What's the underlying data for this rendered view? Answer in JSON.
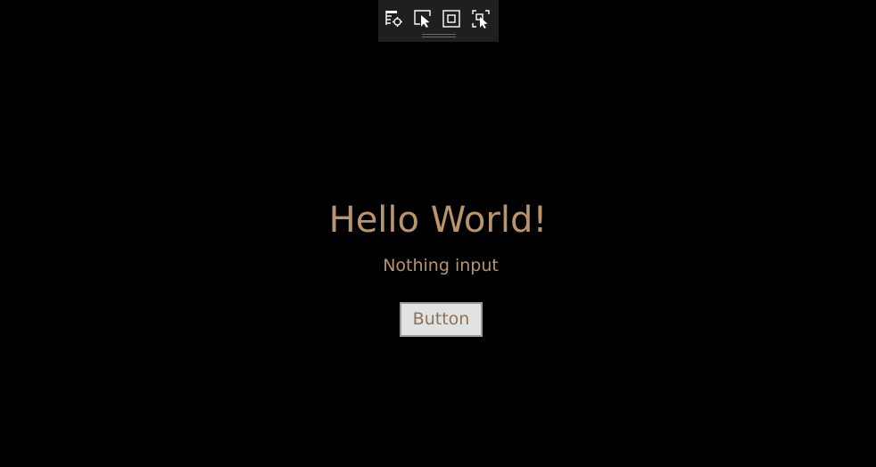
{
  "toolbar": {
    "buttons": [
      {
        "icon": "visual-tree-icon"
      },
      {
        "icon": "select-element-icon"
      },
      {
        "icon": "display-layout-adorners-icon"
      },
      {
        "icon": "track-focused-element-icon"
      }
    ]
  },
  "main": {
    "title": "Hello World!",
    "subtitle": "Nothing input",
    "button_label": "Button"
  },
  "colors": {
    "background": "#000000",
    "text_accent": "#b8956a",
    "button_bg": "#e2e2e2",
    "button_text": "#8c7258",
    "toolbar_bg": "#1f1f1f"
  }
}
